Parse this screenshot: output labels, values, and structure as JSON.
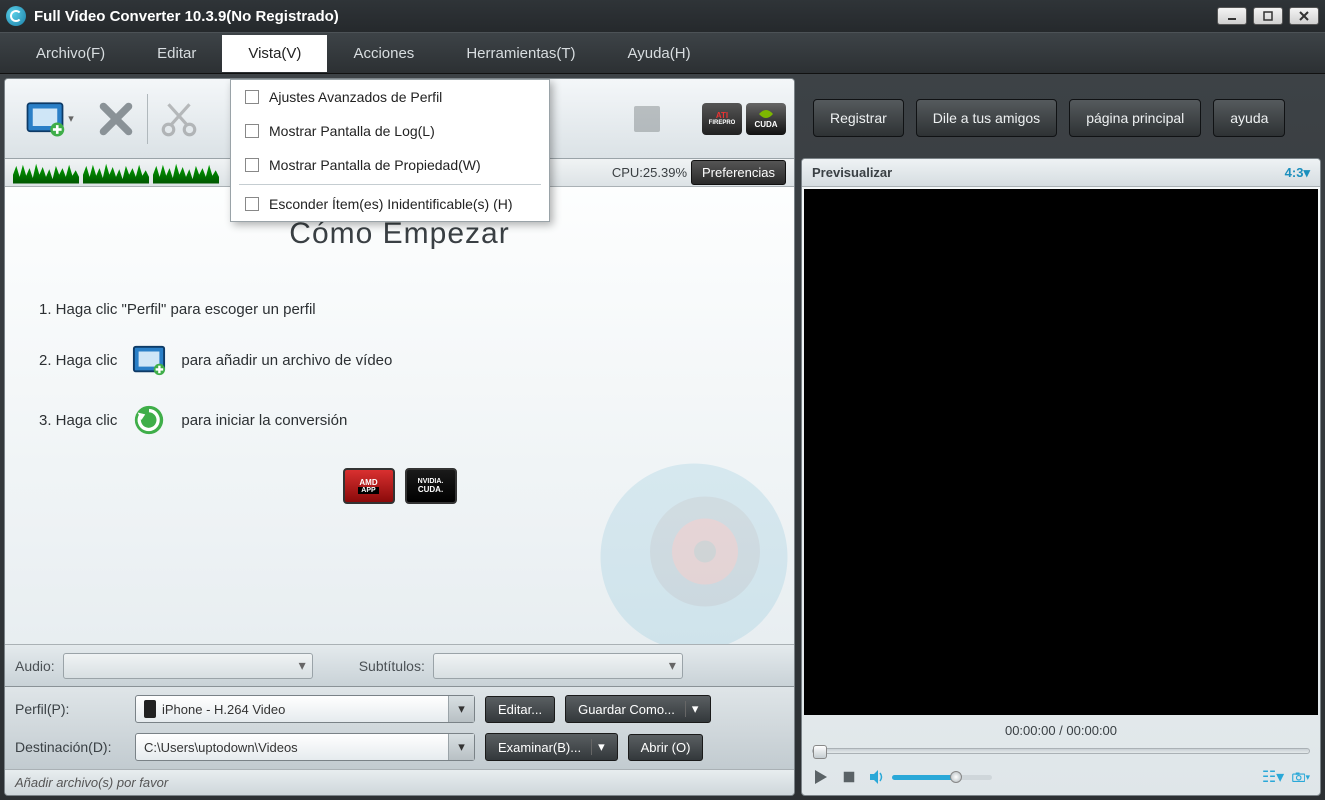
{
  "title": "Full Video Converter 10.3.9(No Registrado)",
  "menu": {
    "archivo": "Archivo(F)",
    "editar": "Editar",
    "vista": "Vista(V)",
    "acciones": "Acciones",
    "herramientas": "Herramientas(T)",
    "ayuda": "Ayuda(H)"
  },
  "vista_dropdown": {
    "ajustes": "Ajustes Avanzados de Perfil",
    "log": "Mostrar Pantalla de Log(L)",
    "propiedad": "Mostrar Pantalla de Propiedad(W)",
    "esconder": "Esconder Ítem(es) Inidentificable(s) (H)"
  },
  "stats": {
    "cpu": "CPU:25.39%",
    "preferencias": "Preferencias"
  },
  "main": {
    "heading": "Cómo Empezar",
    "step1": "1. Haga clic \"Perfil\" para escoger un perfil",
    "step2a": "2. Haga clic",
    "step2b": "para añadir un archivo de vídeo",
    "step3a": "3. Haga clic",
    "step3b": "para iniciar la conversión"
  },
  "badges": {
    "amd_top": "AMD",
    "amd_bot": "APP",
    "nv_top": "NVIDIA.",
    "nv_bot": "CUDA.",
    "ati": "ATI",
    "cuda": "CUDA"
  },
  "audio_row": {
    "audio_label": "Audio:",
    "sub_label": "Subtítulos:"
  },
  "profile": {
    "perfil_label": "Perfil(P):",
    "perfil_value": "iPhone - H.264 Video",
    "editar": "Editar...",
    "guardar": "Guardar Como...",
    "destino_label": "Destinación(D):",
    "destino_value": "C:\\Users\\uptodown\\Videos",
    "examinar": "Examinar(B)...",
    "abrir": "Abrir (O)"
  },
  "status": "Añadir archivo(s) por favor",
  "right_buttons": {
    "registrar": "Registrar",
    "dile": "Dile a tus amigos",
    "pagina": "página principal",
    "ayuda": "ayuda"
  },
  "preview": {
    "title": "Previsualizar",
    "ratio": "4:3",
    "time": "00:00:00 / 00:00:00"
  }
}
